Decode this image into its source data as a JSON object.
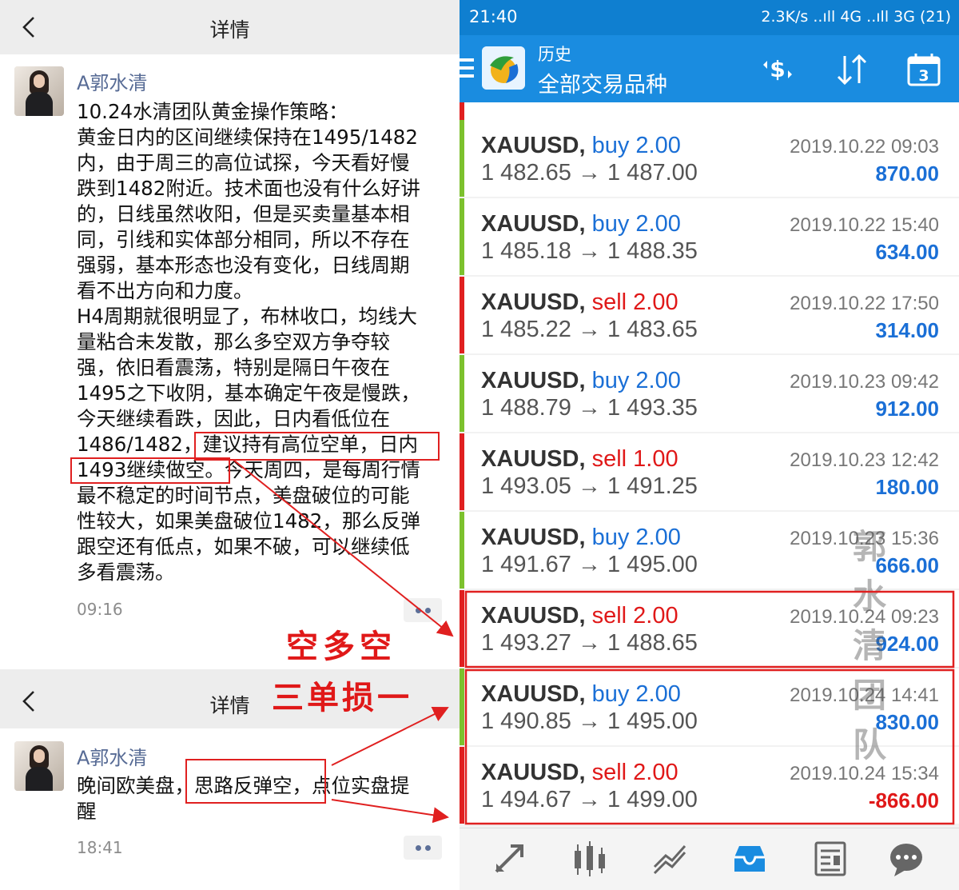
{
  "left": {
    "header1": {
      "title": "详情"
    },
    "post1": {
      "username": "A郭水清",
      "lines": [
        "10.24水清团队黄金操作策略：",
        "黄金日内的区间继续保持在1495/1482",
        "内，由于周三的高位试探，今天看好慢",
        "跌到1482附近。技术面也没有什么好讲",
        "的，日线虽然收阳，但是买卖量基本相",
        "同，引线和实体部分相同，所以不存在",
        "强弱，基本形态也没有变化，日线周期",
        "看不出方向和力度。",
        "H4周期就很明显了，布林收口，均线大",
        "量粘合未发散，那么多空双方争夺较",
        "强，依旧看震荡，特别是隔日午夜在",
        "1495之下收阴，基本确定午夜是慢跌，",
        "今天继续看跌，因此，日内看低位在",
        "1486/1482，建议持有高位空单，日内",
        "1493继续做空。今天周四，是每周行情",
        "最不稳定的时间节点，美盘破位的可能",
        "性较大，如果美盘破位1482，那么反弹",
        "跟空还有低点，如果不破，可以继续低",
        "多看震荡。"
      ],
      "time": "09:16"
    },
    "header2": {
      "title": "详情"
    },
    "post2": {
      "username": "A郭水清",
      "lines": [
        "晚间欧美盘，思路反弹空，点位实盘提",
        "醒"
      ],
      "time": "18:41"
    },
    "annotation": {
      "line1": "空多空",
      "line2": "三单损一"
    }
  },
  "right": {
    "status": {
      "time": "21:40",
      "network": "2.3K/s ..ıll 4G ..ıll 3G (21)"
    },
    "toolbar": {
      "subtitle": "历史",
      "title": "全部交易品种",
      "calendar_day": "3"
    },
    "trades": [
      {
        "symbol": "XAUUSD,",
        "side": "buy",
        "volume": "2.00",
        "prices": "1 482.65 → 1 487.00",
        "datetime": "2019.10.22 09:03",
        "profit": "870.00"
      },
      {
        "symbol": "XAUUSD,",
        "side": "buy",
        "volume": "2.00",
        "prices": "1 485.18 → 1 488.35",
        "datetime": "2019.10.22 15:40",
        "profit": "634.00"
      },
      {
        "symbol": "XAUUSD,",
        "side": "sell",
        "volume": "2.00",
        "prices": "1 485.22 → 1 483.65",
        "datetime": "2019.10.22 17:50",
        "profit": "314.00"
      },
      {
        "symbol": "XAUUSD,",
        "side": "buy",
        "volume": "2.00",
        "prices": "1 488.79 → 1 493.35",
        "datetime": "2019.10.23 09:42",
        "profit": "912.00"
      },
      {
        "symbol": "XAUUSD,",
        "side": "sell",
        "volume": "1.00",
        "prices": "1 493.05 → 1 491.25",
        "datetime": "2019.10.23 12:42",
        "profit": "180.00"
      },
      {
        "symbol": "XAUUSD,",
        "side": "buy",
        "volume": "2.00",
        "prices": "1 491.67 → 1 495.00",
        "datetime": "2019.10.23 15:36",
        "profit": "666.00"
      },
      {
        "symbol": "XAUUSD,",
        "side": "sell",
        "volume": "2.00",
        "prices": "1 493.27 → 1 488.65",
        "datetime": "2019.10.24 09:23",
        "profit": "924.00"
      },
      {
        "symbol": "XAUUSD,",
        "side": "buy",
        "volume": "2.00",
        "prices": "1 490.85 → 1 495.00",
        "datetime": "2019.10.24 14:41",
        "profit": "830.00"
      },
      {
        "symbol": "XAUUSD,",
        "side": "sell",
        "volume": "2.00",
        "prices": "1 494.67 → 1 499.00",
        "datetime": "2019.10.24 15:34",
        "profit": "-866.00"
      }
    ],
    "watermark": [
      "郭",
      "水",
      "清",
      "团",
      "队"
    ],
    "colors": {
      "buy": "#1a6fd6",
      "sell": "#e01818",
      "profit_neg": "#e01818",
      "header": "#1a8ce0",
      "buy_bar": "#7cc12d",
      "sell_bar": "#e02020"
    },
    "tabs": [
      "trade-icon",
      "quotes-icon",
      "chart-icon",
      "history-icon",
      "journal-icon",
      "chat-icon"
    ]
  }
}
